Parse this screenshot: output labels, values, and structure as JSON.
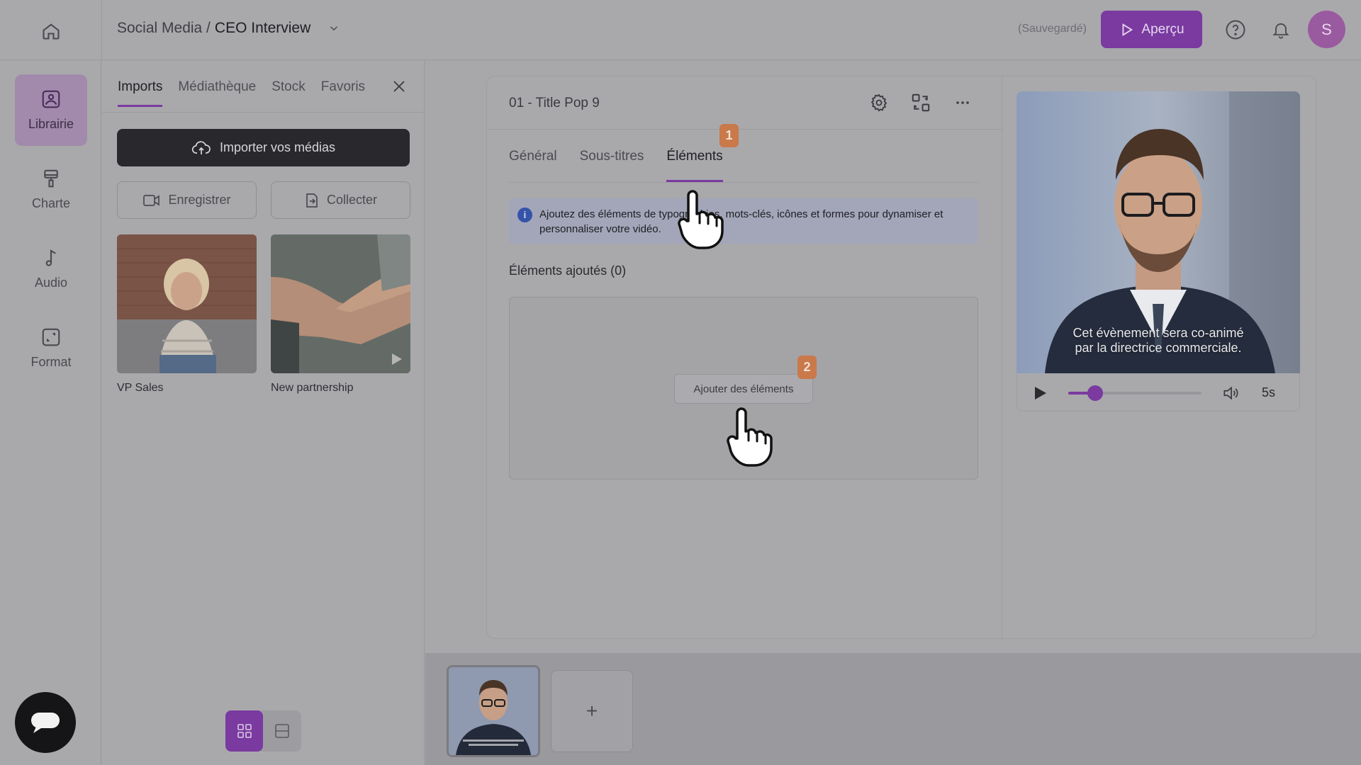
{
  "topbar": {
    "breadcrumb_folder": "Social Media /",
    "breadcrumb_project": "CEO Interview",
    "save_status": "(Sauvegardé)",
    "preview_label": "Aperçu",
    "avatar_initial": "S"
  },
  "rail": {
    "items": [
      {
        "label": "Librairie",
        "icon": "image-icon",
        "active": true
      },
      {
        "label": "Charte",
        "icon": "brush-icon"
      },
      {
        "label": "Audio",
        "icon": "music-note-icon"
      },
      {
        "label": "Format",
        "icon": "resize-icon"
      }
    ]
  },
  "library": {
    "tabs": [
      "Imports",
      "Médiathèque",
      "Stock",
      "Favoris"
    ],
    "active_tab": "Imports",
    "import_label": "Importer vos médias",
    "record_label": "Enregistrer",
    "collect_label": "Collecter",
    "media": [
      {
        "label": "VP Sales",
        "type": "image"
      },
      {
        "label": "New partnership",
        "type": "video"
      }
    ]
  },
  "editor": {
    "scene_title": "01 - Title Pop 9",
    "tabs": [
      "Général",
      "Sous-titres",
      "Éléments"
    ],
    "active_tab": "Éléments",
    "info_text": "Ajoutez des éléments de typographies, mots-clés, icônes et formes pour dynamiser et personnaliser votre vidéo.",
    "added_title": "Éléments ajoutés (0)",
    "add_button": "Ajouter des éléments",
    "step_badges": [
      "1",
      "2"
    ]
  },
  "preview": {
    "subtitle_line1": "Cet évènement sera co-animé",
    "subtitle_line2": "par la directrice commerciale.",
    "progress": 0.2,
    "duration": "5s"
  },
  "timeline": {
    "add_label": "+"
  },
  "colors": {
    "accent": "#7a3aa0",
    "badge": "#c9794a",
    "dark": "#29292d"
  }
}
